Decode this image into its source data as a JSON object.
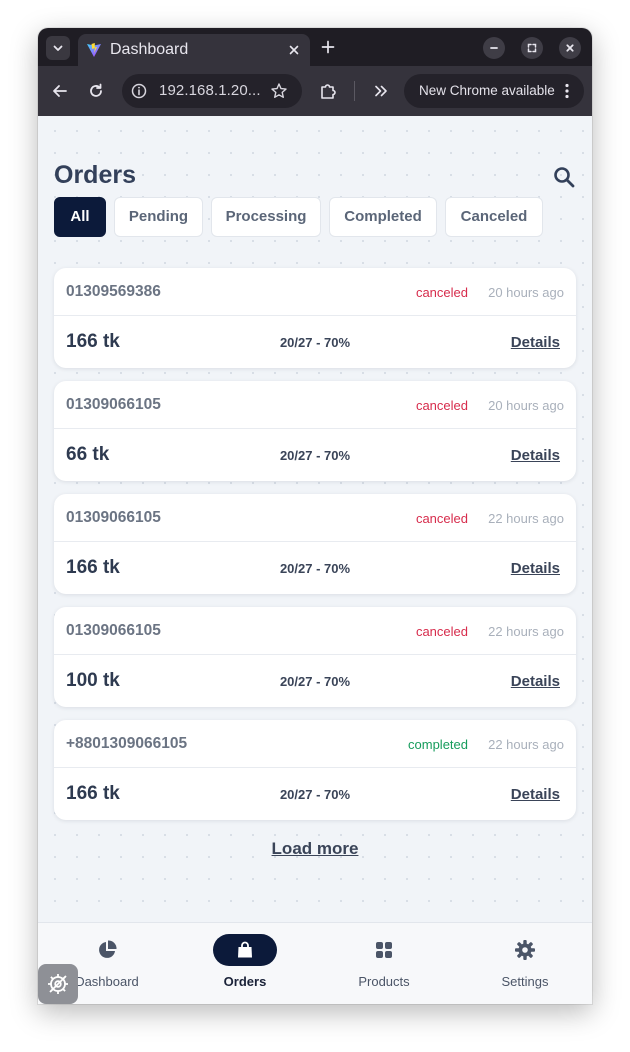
{
  "browser": {
    "tab_title": "Dashboard",
    "url": "192.168.1.20...",
    "update_label": "New Chrome available",
    "icons": {
      "tab_menu": "chevron-down-icon",
      "favicon": "vite-logo-icon",
      "tab_close": "close-icon",
      "new_tab": "plus-icon",
      "minimize": "minimize-icon",
      "maximize": "maximize-icon",
      "window_close": "close-icon",
      "back": "arrow-left-icon",
      "reload": "reload-icon",
      "site_info": "info-icon",
      "bookmark": "star-icon",
      "extensions": "puzzle-icon",
      "overflow": "double-chevron-right-icon",
      "menu": "kebab-menu-icon"
    }
  },
  "page": {
    "title": "Orders",
    "search_icon": "search-icon"
  },
  "filters": {
    "items": [
      {
        "label": "All",
        "active": true
      },
      {
        "label": "Pending",
        "active": false
      },
      {
        "label": "Processing",
        "active": false
      },
      {
        "label": "Completed",
        "active": false
      },
      {
        "label": "Canceled",
        "active": false
      }
    ]
  },
  "orders": [
    {
      "phone": "01309569386",
      "status": "canceled",
      "time": "20 hours ago",
      "amount": "166 tk",
      "progress": "20/27 - 70%",
      "details_label": "Details"
    },
    {
      "phone": "01309066105",
      "status": "canceled",
      "time": "20 hours ago",
      "amount": "66 tk",
      "progress": "20/27 - 70%",
      "details_label": "Details"
    },
    {
      "phone": "01309066105",
      "status": "canceled",
      "time": "22 hours ago",
      "amount": "166 tk",
      "progress": "20/27 - 70%",
      "details_label": "Details"
    },
    {
      "phone": "01309066105",
      "status": "canceled",
      "time": "22 hours ago",
      "amount": "100 tk",
      "progress": "20/27 - 70%",
      "details_label": "Details"
    },
    {
      "phone": "+8801309066105",
      "status": "completed",
      "time": "22 hours ago",
      "amount": "166 tk",
      "progress": "20/27 - 70%",
      "details_label": "Details"
    }
  ],
  "load_more_label": "Load more",
  "bottom_nav": {
    "items": [
      {
        "label": "Dashboard",
        "icon": "pie-chart-icon",
        "active": false
      },
      {
        "label": "Orders",
        "icon": "shopping-bag-icon",
        "active": true
      },
      {
        "label": "Products",
        "icon": "grid-icon",
        "active": false
      },
      {
        "label": "Settings",
        "icon": "gear-icon",
        "active": false
      }
    ]
  },
  "colors": {
    "accent": "#0c1a3a",
    "canceled": "#d72c4c",
    "completed": "#169c5c",
    "title": "#33405a"
  }
}
